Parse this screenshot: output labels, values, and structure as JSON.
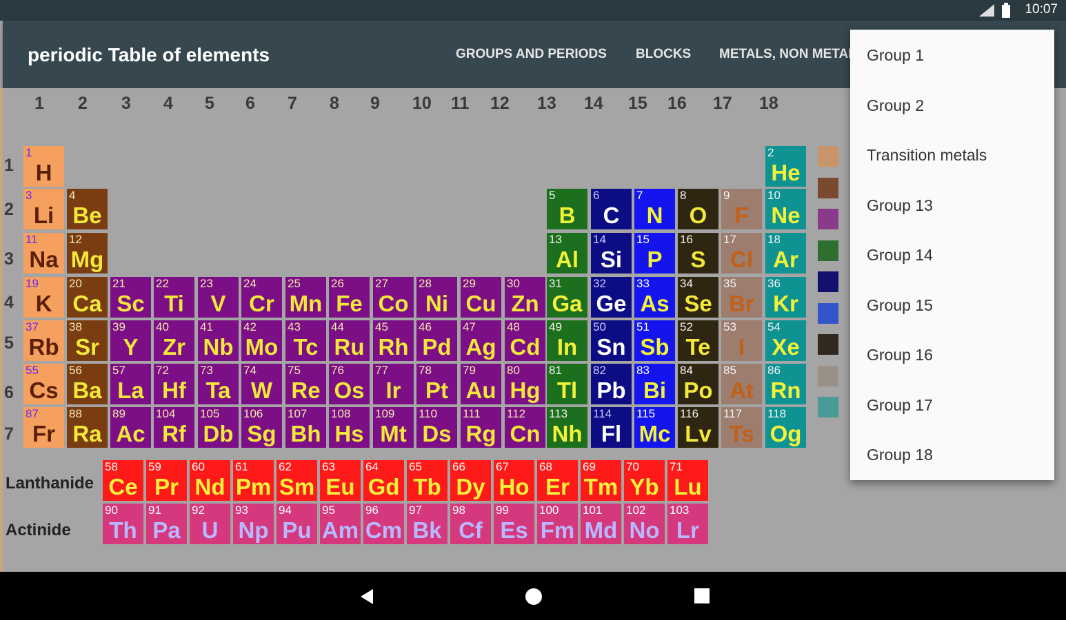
{
  "status_bar": {
    "time": "10:07",
    "icons": [
      "signal-icon",
      "battery-icon"
    ]
  },
  "toolbar": {
    "title": "periodic Table of elements",
    "tabs": [
      "GROUPS AND PERIODS",
      "BLOCKS",
      "METALS, NON METALS"
    ]
  },
  "table": {
    "group_numbers": [
      "1",
      "2",
      "3",
      "4",
      "5",
      "6",
      "7",
      "8",
      "9",
      "10",
      "11",
      "12",
      "13",
      "14",
      "15",
      "16",
      "17",
      "18"
    ],
    "period_numbers": [
      "1",
      "2",
      "3",
      "4",
      "5",
      "6",
      "7"
    ],
    "lanthanide_label": "Lanthanide",
    "actinide_label": "Actinide",
    "elements": [
      {
        "n": "1",
        "s": "H"
      },
      {
        "n": "2",
        "s": "He"
      },
      {
        "n": "3",
        "s": "Li"
      },
      {
        "n": "4",
        "s": "Be"
      },
      {
        "n": "5",
        "s": "B"
      },
      {
        "n": "6",
        "s": "C"
      },
      {
        "n": "7",
        "s": "N"
      },
      {
        "n": "8",
        "s": "O"
      },
      {
        "n": "9",
        "s": "F"
      },
      {
        "n": "10",
        "s": "Ne"
      },
      {
        "n": "11",
        "s": "Na"
      },
      {
        "n": "12",
        "s": "Mg"
      },
      {
        "n": "13",
        "s": "Al"
      },
      {
        "n": "14",
        "s": "Si"
      },
      {
        "n": "15",
        "s": "P"
      },
      {
        "n": "16",
        "s": "S"
      },
      {
        "n": "17",
        "s": "Cl"
      },
      {
        "n": "18",
        "s": "Ar"
      },
      {
        "n": "19",
        "s": "K"
      },
      {
        "n": "20",
        "s": "Ca"
      },
      {
        "n": "21",
        "s": "Sc"
      },
      {
        "n": "22",
        "s": "Ti"
      },
      {
        "n": "23",
        "s": "V"
      },
      {
        "n": "24",
        "s": "Cr"
      },
      {
        "n": "25",
        "s": "Mn"
      },
      {
        "n": "26",
        "s": "Fe"
      },
      {
        "n": "27",
        "s": "Co"
      },
      {
        "n": "28",
        "s": "Ni"
      },
      {
        "n": "29",
        "s": "Cu"
      },
      {
        "n": "30",
        "s": "Zn"
      },
      {
        "n": "31",
        "s": "Ga"
      },
      {
        "n": "32",
        "s": "Ge"
      },
      {
        "n": "33",
        "s": "As"
      },
      {
        "n": "34",
        "s": "Se"
      },
      {
        "n": "35",
        "s": "Br"
      },
      {
        "n": "36",
        "s": "Kr"
      },
      {
        "n": "37",
        "s": "Rb"
      },
      {
        "n": "38",
        "s": "Sr"
      },
      {
        "n": "39",
        "s": "Y"
      },
      {
        "n": "40",
        "s": "Zr"
      },
      {
        "n": "41",
        "s": "Nb"
      },
      {
        "n": "42",
        "s": "Mo"
      },
      {
        "n": "43",
        "s": "Tc"
      },
      {
        "n": "44",
        "s": "Ru"
      },
      {
        "n": "45",
        "s": "Rh"
      },
      {
        "n": "46",
        "s": "Pd"
      },
      {
        "n": "47",
        "s": "Ag"
      },
      {
        "n": "48",
        "s": "Cd"
      },
      {
        "n": "49",
        "s": "In"
      },
      {
        "n": "50",
        "s": "Sn"
      },
      {
        "n": "51",
        "s": "Sb"
      },
      {
        "n": "52",
        "s": "Te"
      },
      {
        "n": "53",
        "s": "I"
      },
      {
        "n": "54",
        "s": "Xe"
      },
      {
        "n": "55",
        "s": "Cs"
      },
      {
        "n": "56",
        "s": "Ba"
      },
      {
        "n": "57",
        "s": "La"
      },
      {
        "n": "72",
        "s": "Hf"
      },
      {
        "n": "73",
        "s": "Ta"
      },
      {
        "n": "74",
        "s": "W"
      },
      {
        "n": "75",
        "s": "Re"
      },
      {
        "n": "76",
        "s": "Os"
      },
      {
        "n": "77",
        "s": "Ir"
      },
      {
        "n": "78",
        "s": "Pt"
      },
      {
        "n": "79",
        "s": "Au"
      },
      {
        "n": "80",
        "s": "Hg"
      },
      {
        "n": "81",
        "s": "Tl"
      },
      {
        "n": "82",
        "s": "Pb"
      },
      {
        "n": "83",
        "s": "Bi"
      },
      {
        "n": "84",
        "s": "Po"
      },
      {
        "n": "85",
        "s": "At"
      },
      {
        "n": "86",
        "s": "Rn"
      },
      {
        "n": "87",
        "s": "Fr"
      },
      {
        "n": "88",
        "s": "Ra"
      },
      {
        "n": "89",
        "s": "Ac"
      },
      {
        "n": "104",
        "s": "Rf"
      },
      {
        "n": "105",
        "s": "Db"
      },
      {
        "n": "106",
        "s": "Sg"
      },
      {
        "n": "107",
        "s": "Bh"
      },
      {
        "n": "108",
        "s": "Hs"
      },
      {
        "n": "109",
        "s": "Mt"
      },
      {
        "n": "110",
        "s": "Ds"
      },
      {
        "n": "111",
        "s": "Rg"
      },
      {
        "n": "112",
        "s": "Cn"
      },
      {
        "n": "113",
        "s": "Nh"
      },
      {
        "n": "114",
        "s": "Fl"
      },
      {
        "n": "115",
        "s": "Mc"
      },
      {
        "n": "116",
        "s": "Lv"
      },
      {
        "n": "117",
        "s": "Ts"
      },
      {
        "n": "118",
        "s": "Og"
      },
      {
        "n": "58",
        "s": "Ce"
      },
      {
        "n": "59",
        "s": "Pr"
      },
      {
        "n": "60",
        "s": "Nd"
      },
      {
        "n": "61",
        "s": "Pm"
      },
      {
        "n": "62",
        "s": "Sm"
      },
      {
        "n": "63",
        "s": "Eu"
      },
      {
        "n": "64",
        "s": "Gd"
      },
      {
        "n": "65",
        "s": "Tb"
      },
      {
        "n": "66",
        "s": "Dy"
      },
      {
        "n": "67",
        "s": "Ho"
      },
      {
        "n": "68",
        "s": "Er"
      },
      {
        "n": "69",
        "s": "Tm"
      },
      {
        "n": "70",
        "s": "Yb"
      },
      {
        "n": "71",
        "s": "Lu"
      },
      {
        "n": "90",
        "s": "Th"
      },
      {
        "n": "91",
        "s": "Pa"
      },
      {
        "n": "92",
        "s": "U"
      },
      {
        "n": "93",
        "s": "Np"
      },
      {
        "n": "94",
        "s": "Pu"
      },
      {
        "n": "95",
        "s": "Am"
      },
      {
        "n": "96",
        "s": "Cm"
      },
      {
        "n": "97",
        "s": "Bk"
      },
      {
        "n": "98",
        "s": "Cf"
      },
      {
        "n": "99",
        "s": "Es"
      },
      {
        "n": "100",
        "s": "Fm"
      },
      {
        "n": "101",
        "s": "Md"
      },
      {
        "n": "102",
        "s": "No"
      },
      {
        "n": "103",
        "s": "Lr"
      }
    ]
  },
  "colors": {
    "group1": "#f5a05e",
    "group2": "#7a3d12",
    "transition": "#7c0f86",
    "g13": "#1c6f1c",
    "g14": "#0c0c84",
    "g15": "#1414ee",
    "g16": "#2e2610",
    "g17": "#9c7d6e",
    "g18": "#0f9292",
    "lanthanide": "#ff1a1a",
    "actinide": "#d5387c"
  },
  "legend_colors": [
    "#c8946a",
    "#7a4a2e",
    "#8a3a8a",
    "#2e6e2e",
    "#12126e",
    "#3355cc",
    "#302a1e",
    "#9a9088",
    "#4a9a96"
  ],
  "dropdown": {
    "items": [
      "Group 1",
      "Group 2",
      "Transition metals",
      "Group 13",
      "Group 14",
      "Group 15",
      "Group 16",
      "Group 17",
      "Group 18"
    ]
  }
}
